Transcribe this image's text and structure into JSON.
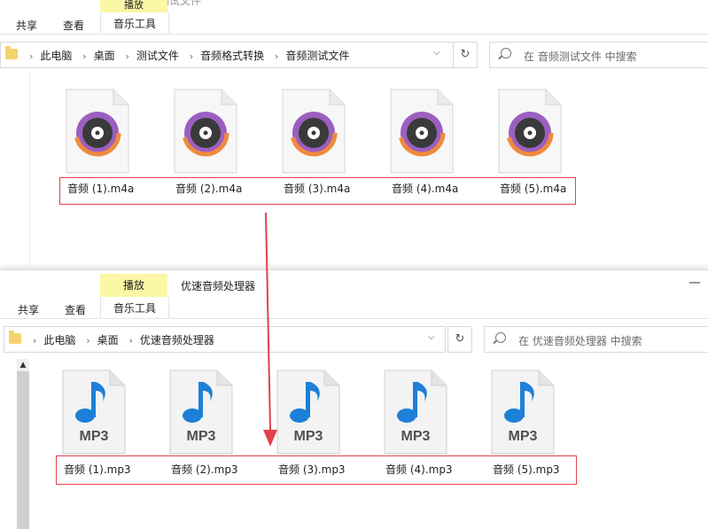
{
  "top_window": {
    "partial_title": "音频测试文件",
    "tabs": {
      "share": "共享",
      "view": "查看",
      "music_tools": "音乐工具",
      "play": "播放"
    },
    "breadcrumb": [
      "此电脑",
      "桌面",
      "测试文件",
      "音频格式转换",
      "音频测试文件"
    ],
    "search_placeholder": "在 音频测试文件 中搜索",
    "files": [
      "音频 (1).m4a",
      "音频 (2).m4a",
      "音频 (3).m4a",
      "音频 (4).m4a",
      "音频 (5).m4a"
    ]
  },
  "bottom_window": {
    "title": "优速音频处理器",
    "tabs": {
      "share": "共享",
      "view": "查看",
      "music_tools": "音乐工具",
      "play": "播放"
    },
    "breadcrumb": [
      "此电脑",
      "桌面",
      "优速音频处理器"
    ],
    "search_placeholder": "在 优速音频处理器 中搜索",
    "files": [
      "音频 (1).mp3",
      "音频 (2).mp3",
      "音频 (3).mp3",
      "音频 (4).mp3",
      "音频 (5).mp3"
    ],
    "icon_label": "MP3"
  },
  "colors": {
    "highlight": "#fbf7a6",
    "annotation_red": "#e2424c",
    "music_note_blue": "#1e7fd8"
  }
}
